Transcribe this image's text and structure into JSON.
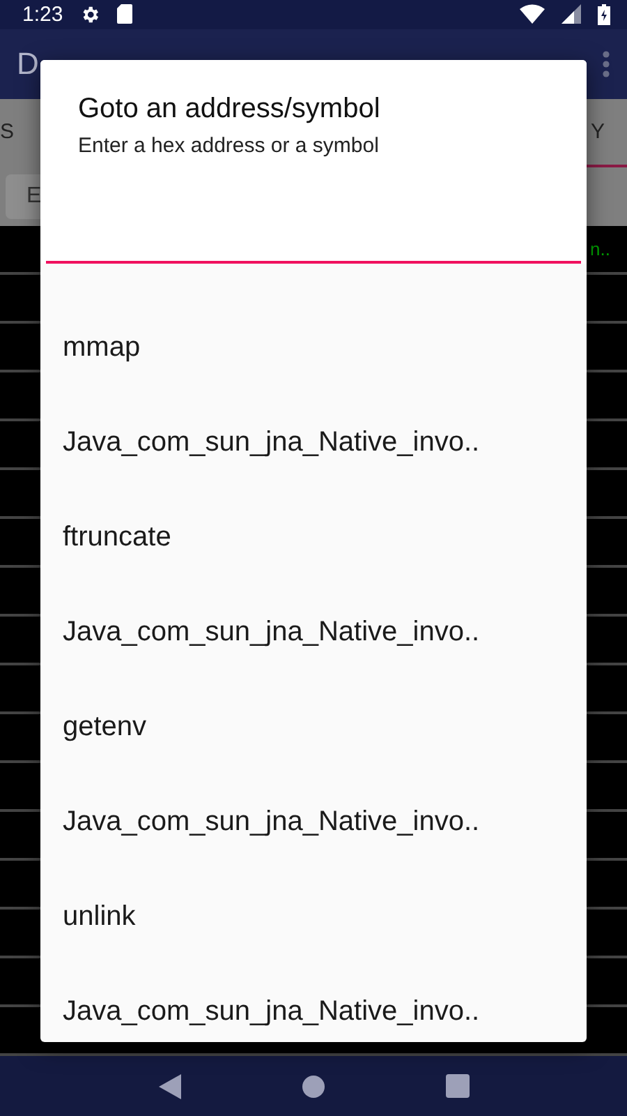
{
  "status_bar": {
    "time": "1:23"
  },
  "app_bar": {
    "title": "D"
  },
  "tabs": [
    {
      "label": "S",
      "selected": false
    },
    {
      "label": "Y",
      "selected": true
    }
  ],
  "search": {
    "placeholder": "E"
  },
  "listing": {
    "cells": [
      "n.."
    ]
  },
  "dialog": {
    "title": "Goto an address/symbol",
    "message": "Enter a hex address or a symbol",
    "suggestions": [
      "mmap",
      "Java_com_sun_jna_Native_invo..",
      "ftruncate",
      "Java_com_sun_jna_Native_invo..",
      "getenv",
      "Java_com_sun_jna_Native_invo..",
      "unlink",
      "Java_com_sun_jna_Native_invo.."
    ]
  }
}
